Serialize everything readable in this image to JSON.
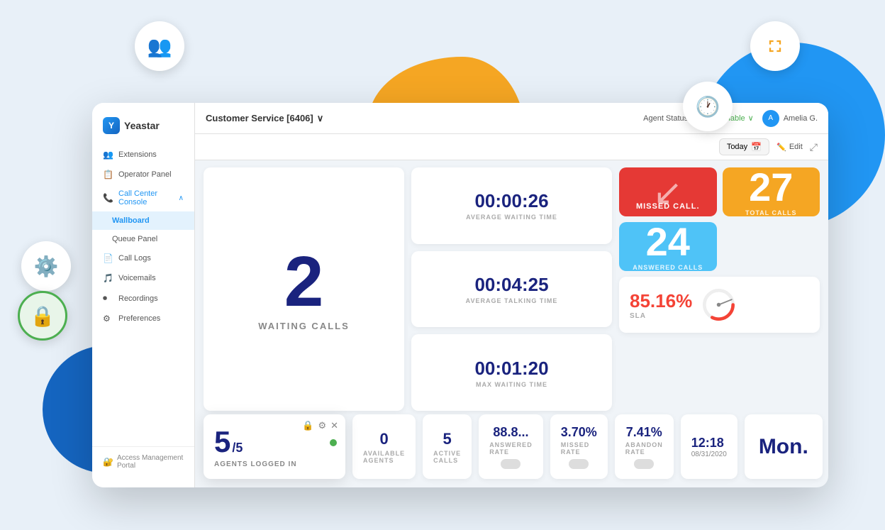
{
  "decorative": {
    "blobs": [
      "orange",
      "blue-right",
      "blue-bottom"
    ],
    "floatingIcons": [
      "team",
      "clock",
      "expand",
      "gear",
      "lock"
    ]
  },
  "header": {
    "logo": "Yeastar",
    "queue": "Customer Service [6406]",
    "agentStatus": "Agent Status",
    "available": "Available",
    "user": "Amelia G.",
    "dateFilter": "Today",
    "editLabel": "Edit"
  },
  "sidebar": {
    "items": [
      {
        "label": "Extensions",
        "icon": "👥"
      },
      {
        "label": "Operator Panel",
        "icon": "📋"
      },
      {
        "label": "Call Center Console",
        "icon": "📞",
        "active": true,
        "expanded": true
      },
      {
        "label": "Wallboard",
        "sub": true,
        "activeLink": true
      },
      {
        "label": "Queue Panel",
        "sub": true
      },
      {
        "label": "Call Logs",
        "icon": "📄"
      },
      {
        "label": "Voicemails",
        "icon": "🎵"
      },
      {
        "label": "Recordings",
        "icon": "⏺"
      },
      {
        "label": "Preferences",
        "icon": "⚙"
      }
    ],
    "accessPortal": "Access Management Portal"
  },
  "metrics": {
    "waitingCalls": {
      "value": "2",
      "label": "WAITING CALLS"
    },
    "avgWaitingTime": {
      "value": "00:00:26",
      "label": "AVERAGE WAITING TIME"
    },
    "avgTalkingTime": {
      "value": "00:04:25",
      "label": "AVERAGE TALKING TIME"
    },
    "maxWaitingTime": {
      "value": "00:01:20",
      "label": "MAX WAITING TIME"
    },
    "missedCall": {
      "label": "MISSED CALL."
    },
    "answeredCalls": {
      "value": "24",
      "label": "ANSWERED CALLS"
    },
    "totalCalls": {
      "value": "27",
      "label": "TOTAL CALLS"
    },
    "agentsLoggedIn": {
      "value": "5",
      "denominator": "/5",
      "label": "AGENTS LOGGED IN"
    },
    "availableAgents": {
      "value": "0",
      "label": "AVAILABLE AGENTS"
    },
    "activeCalls": {
      "value": "5",
      "label": "ACTIVE CALLS"
    },
    "sla": {
      "value": "85.16%",
      "label": "SLA"
    },
    "answeredRate": {
      "value": "88.8...",
      "label": "ANSWERED RATE"
    },
    "missedRate": {
      "value": "3.70%",
      "label": "MISSED RATE"
    },
    "abandonRate": {
      "value": "7.41%",
      "label": "ABANDON RATE"
    },
    "time": {
      "value": "12:18",
      "date": "08/31/2020"
    },
    "day": {
      "value": "Mon."
    }
  }
}
